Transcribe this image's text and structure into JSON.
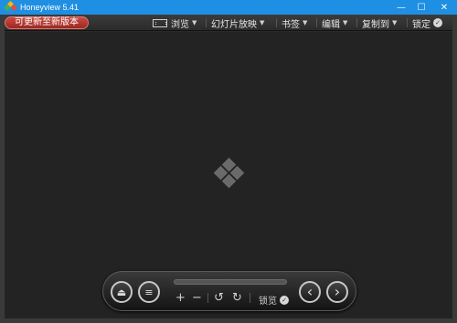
{
  "window": {
    "title": "Honeyview 5.41",
    "controls": {
      "minimize": "—",
      "maximize": "☐",
      "close": "✕"
    }
  },
  "toolbar": {
    "update_label": "可更新至新版本",
    "menus": [
      {
        "label": "浏览",
        "icon": "browse-icon"
      },
      {
        "label": "幻灯片放映"
      },
      {
        "label": "书签"
      },
      {
        "label": "编辑"
      },
      {
        "label": "复制到"
      },
      {
        "label": "锁定",
        "icon": "check-circle-icon"
      }
    ]
  },
  "panel": {
    "eject_icon": "⏏",
    "menu_icon": "≡",
    "zoom_in": "+",
    "zoom_out": "−",
    "rotate_left": "↺",
    "rotate_right": "↻",
    "lock_label": "锁览",
    "lock_check": "✓",
    "prev_icon": "‹",
    "next_icon": "›"
  },
  "colors": {
    "titlebar": "#1e8fe2",
    "update_button": "#b53a33",
    "viewer_bg": "#232323"
  }
}
